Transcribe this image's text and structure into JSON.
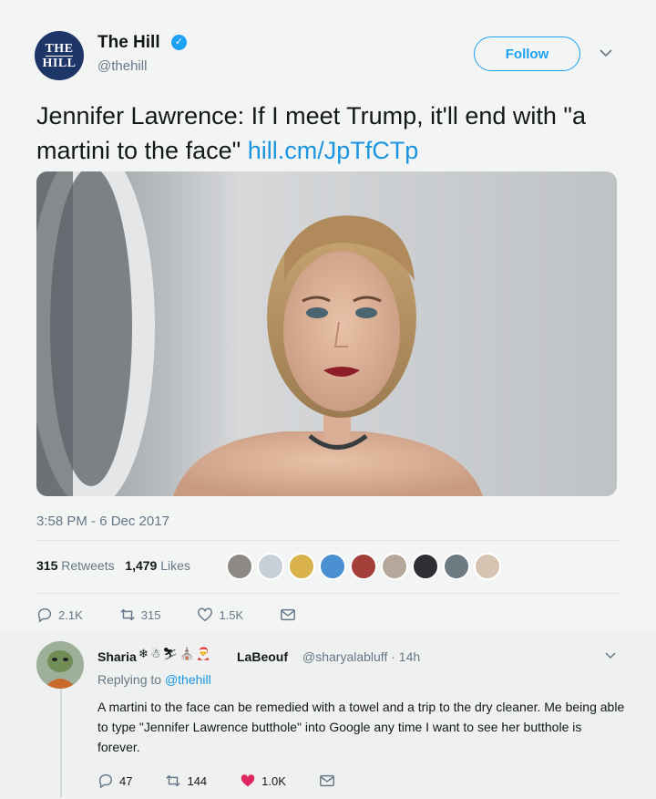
{
  "tweet": {
    "avatar_text_1": "THE",
    "avatar_text_2": "HILL",
    "name": "The Hill",
    "handle": "@thehill",
    "follow_label": "Follow",
    "text": "Jennifer Lawrence: If I meet Trump, it'll end with \"a martini to the face\" ",
    "link": "hill.cm/JpTfCTp",
    "timestamp": "3:58 PM - 6 Dec 2017",
    "retweets_count": "315",
    "retweets_label": "Retweets",
    "likes_count": "1,479",
    "likes_label": "Likes",
    "actions": {
      "replies": "2.1K",
      "retweets": "315",
      "likes": "1.5K"
    }
  },
  "reply": {
    "name": "Sharia",
    "emojis": "❄☃⛷⛪🎅",
    "name_suffix": "LaBeouf",
    "handle_time": "@sharyalabluff · 14h",
    "replying_prefix": "Replying to",
    "replying_handle": "@thehill",
    "text": "A martini to the face can be remedied with a towel and a trip to the dry cleaner. Me being able to type \"Jennifer Lawrence butthole\" into Google any time I want to see her butthole is forever.",
    "actions": {
      "replies": "47",
      "retweets": "144",
      "likes": "1.0K"
    }
  },
  "colors": {
    "accent": "#1da1f2",
    "link": "#1b95e0",
    "muted": "#657786",
    "like_red": "#e0245e"
  }
}
